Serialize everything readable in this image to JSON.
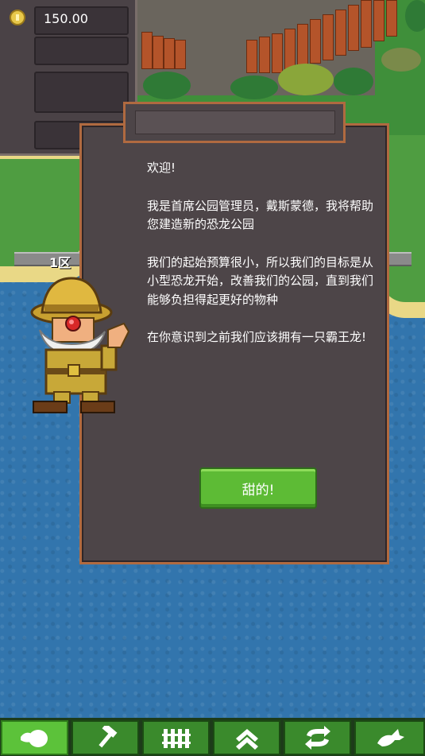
{
  "hud": {
    "money": "150.00",
    "coin_icon": "coin-icon"
  },
  "map": {
    "zone_label": "1区"
  },
  "dialog": {
    "lines": [
      "欢迎!",
      "我是首席公园管理员，戴斯蒙德，我将帮助您建造新的恐龙公园",
      "我们的起始预算很小，所以我们的目标是从小型恐龙开始，改善我们的公园，直到我们能够负担得起更好的物种",
      "在你意识到之前我们应该拥有一只霸王龙!"
    ],
    "ok_label": "甜的!"
  },
  "toolbar": {
    "items": [
      {
        "icon": "dinosaur-egg-icon",
        "active": true
      },
      {
        "icon": "hammer-icon",
        "active": false
      },
      {
        "icon": "fence-icon",
        "active": false
      },
      {
        "icon": "upgrade-chevron-icon",
        "active": false
      },
      {
        "icon": "swap-arrows-icon",
        "active": false
      },
      {
        "icon": "dragon-icon",
        "active": false
      }
    ]
  },
  "colors": {
    "button_green": "#5dbb35",
    "dialog_bg": "#4d4548",
    "dialog_border": "#b06a40",
    "water": "#3275ad"
  }
}
